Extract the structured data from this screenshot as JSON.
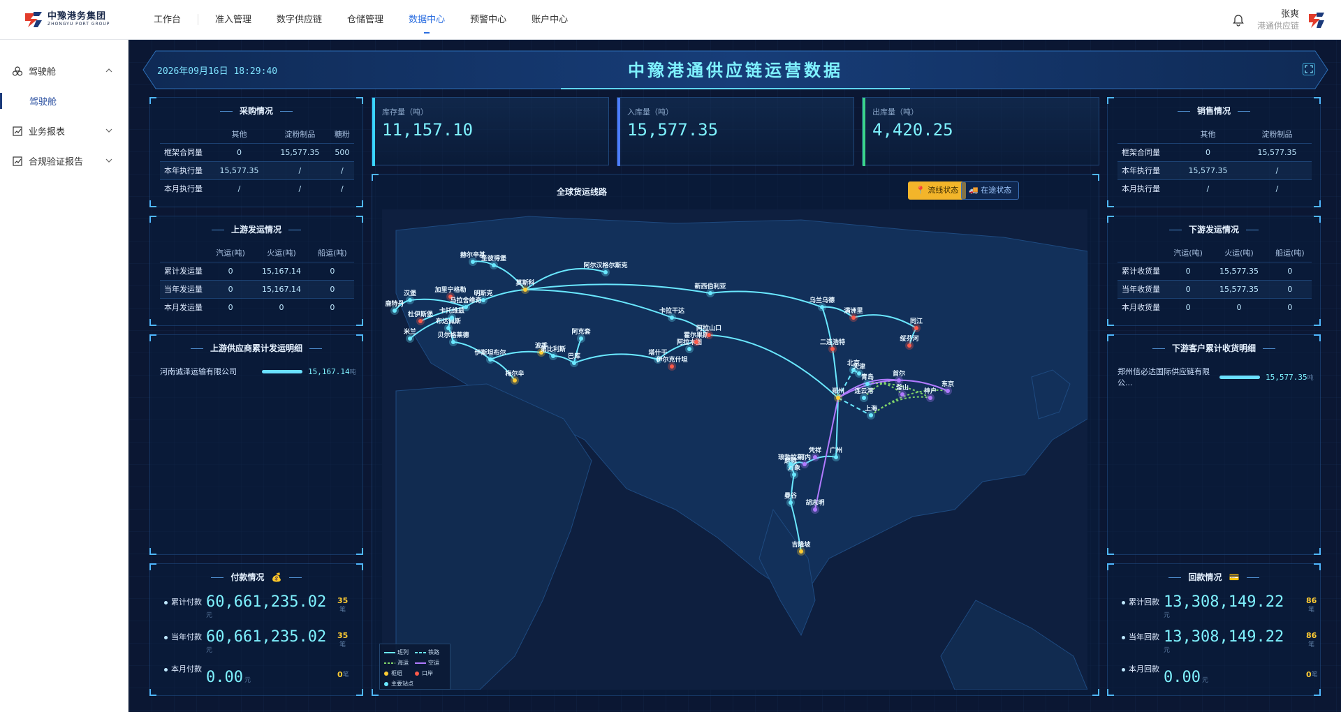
{
  "header": {
    "logo_cn": "中豫港务集团",
    "logo_en": "ZHONGYU PORT GROUP",
    "nav": [
      {
        "label": "工作台"
      },
      {
        "label": "准入管理"
      },
      {
        "label": "数字供应链"
      },
      {
        "label": "仓储管理"
      },
      {
        "label": "数据中心",
        "active": true
      },
      {
        "label": "预警中心"
      },
      {
        "label": "账户中心"
      }
    ],
    "user_name": "张爽",
    "user_company": "港通供应链"
  },
  "sidebar": {
    "groups": [
      {
        "label": "驾驶舱",
        "expanded": true,
        "children": [
          "驾驶舱"
        ]
      },
      {
        "label": "业务报表",
        "expanded": false
      },
      {
        "label": "合规验证报告",
        "expanded": false
      }
    ]
  },
  "dashboard": {
    "datetime": "2026年09月16日  18:29:40",
    "title": "中豫港通供应链运营数据"
  },
  "purchase": {
    "title": "采购情况",
    "columns": [
      "",
      "其他",
      "淀粉制品",
      "糖粉"
    ],
    "rows": [
      [
        "框架合同量",
        "0",
        "15,577.35",
        "500"
      ],
      [
        "本年执行量",
        "15,577.35",
        "/",
        "/"
      ],
      [
        "本月执行量",
        "/",
        "/",
        "/"
      ]
    ]
  },
  "upstream": {
    "title": "上游发运情况",
    "columns": [
      "",
      "汽运(吨)",
      "火运(吨)",
      "船运(吨)"
    ],
    "rows": [
      [
        "累计发运量",
        "0",
        "15,167.14",
        "0"
      ],
      [
        "当年发运量",
        "0",
        "15,167.14",
        "0"
      ],
      [
        "本月发运量",
        "0",
        "0",
        "0"
      ]
    ]
  },
  "upstream_rank": {
    "title": "上游供应商累计发运明细",
    "items": [
      {
        "name": "河南诚泽运输有限公司",
        "value": "15,167.14",
        "unit": "吨",
        "ratio": 1.0
      }
    ]
  },
  "payment": {
    "title": "付款情况",
    "unit": "元",
    "count_unit": "笔",
    "rows": [
      {
        "label": "累计付款",
        "value": "60,661,235.02",
        "count": "35"
      },
      {
        "label": "当年付款",
        "value": "60,661,235.02",
        "count": "35"
      },
      {
        "label": "本月付款",
        "value": "0.00",
        "count": "0"
      }
    ]
  },
  "stats": [
    {
      "label": "库存量（吨）",
      "value": "11,157.10",
      "color": "#3ad4ff"
    },
    {
      "label": "入库量（吨）",
      "value": "15,577.35",
      "color": "#4d7cff"
    },
    {
      "label": "出库量（吨）",
      "value": "4,420.25",
      "color": "#3ad48a"
    }
  ],
  "map": {
    "title": "全球货运线路",
    "btn_route": "流线状态",
    "btn_transit": "在途状态",
    "cities": [
      {
        "name": "赫尔辛基"
      },
      {
        "name": "圣彼得堡"
      },
      {
        "name": "阿尔汉格尔斯克"
      },
      {
        "name": "莫斯科"
      },
      {
        "name": "新西伯利亚"
      },
      {
        "name": "加里宁格勒"
      },
      {
        "name": "明斯克"
      },
      {
        "name": "马拉舍维奇"
      },
      {
        "name": "汉堡"
      },
      {
        "name": "鹿特丹"
      },
      {
        "name": "杜伊斯堡"
      },
      {
        "name": "布达佩斯"
      },
      {
        "name": "卡托维兹"
      },
      {
        "name": "米兰"
      },
      {
        "name": "贝尔格莱德"
      },
      {
        "name": "伊斯坦布尔"
      },
      {
        "name": "梅尔辛"
      },
      {
        "name": "波季"
      },
      {
        "name": "第比利斯"
      },
      {
        "name": "巴库"
      },
      {
        "name": "阿克套"
      },
      {
        "name": "卡拉干达"
      },
      {
        "name": "阿拉木图"
      },
      {
        "name": "霍尔果斯"
      },
      {
        "name": "阿拉山口"
      },
      {
        "name": "塔什干"
      },
      {
        "name": "伊尔克什坦"
      },
      {
        "name": "乌兰乌德"
      },
      {
        "name": "满洲里"
      },
      {
        "name": "二连浩特"
      },
      {
        "name": "同江"
      },
      {
        "name": "绥芬河"
      },
      {
        "name": "北京"
      },
      {
        "name": "天津"
      },
      {
        "name": "郑州"
      },
      {
        "name": "青岛"
      },
      {
        "name": "连云港"
      },
      {
        "name": "上海"
      },
      {
        "name": "首尔"
      },
      {
        "name": "釜山"
      },
      {
        "name": "神户"
      },
      {
        "name": "东京"
      },
      {
        "name": "广州"
      },
      {
        "name": "河内"
      },
      {
        "name": "凭祥"
      },
      {
        "name": "磨憨"
      },
      {
        "name": "曼谷"
      },
      {
        "name": "万象"
      },
      {
        "name": "琅勃拉邦"
      },
      {
        "name": "胡志明"
      },
      {
        "name": "吉隆坡"
      }
    ],
    "legend": {
      "rail": "班列",
      "railway": "铁路",
      "sea": "海运",
      "air": "空运",
      "hub": "枢纽",
      "port": "口岸",
      "stop": "主要站点"
    }
  },
  "sales": {
    "title": "销售情况",
    "columns": [
      "",
      "其他",
      "淀粉制品"
    ],
    "rows": [
      [
        "框架合同量",
        "0",
        "15,577.35"
      ],
      [
        "本年执行量",
        "15,577.35",
        "/"
      ],
      [
        "本月执行量",
        "/",
        "/"
      ]
    ]
  },
  "downstream": {
    "title": "下游发运情况",
    "columns": [
      "",
      "汽运(吨)",
      "火运(吨)",
      "船运(吨)"
    ],
    "rows": [
      [
        "累计收货量",
        "0",
        "15,577.35",
        "0"
      ],
      [
        "当年收货量",
        "0",
        "15,577.35",
        "0"
      ],
      [
        "本月收货量",
        "0",
        "0",
        "0"
      ]
    ]
  },
  "downstream_rank": {
    "title": "下游客户累计收货明细",
    "items": [
      {
        "name": "郑州信必达国际供应链有限公...",
        "value": "15,577.35",
        "unit": "吨",
        "ratio": 1.0
      }
    ]
  },
  "collection": {
    "title": "回款情况",
    "unit": "元",
    "count_unit": "笔",
    "rows": [
      {
        "label": "累计回款",
        "value": "13,308,149.22",
        "count": "86"
      },
      {
        "label": "当年回款",
        "value": "13,308,149.22",
        "count": "86"
      },
      {
        "label": "本月回款",
        "value": "0.00",
        "count": "0"
      }
    ]
  }
}
